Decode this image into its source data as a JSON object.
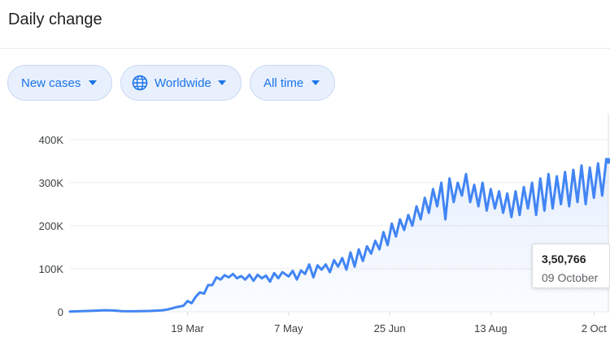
{
  "header": {
    "title": "Daily change"
  },
  "filters": {
    "metric": "New cases",
    "region": "Worldwide",
    "period": "All time"
  },
  "icons": {
    "globe": "globe-icon",
    "dropdown": "caret-down-icon"
  },
  "colors": {
    "line": "#4285f4",
    "accent": "#1a73e8",
    "chip_bg": "#e8f0fe"
  },
  "tooltip": {
    "value": "3,50,766",
    "date": "09 October"
  },
  "chart_data": {
    "type": "area",
    "title": "",
    "xlabel": "",
    "ylabel": "",
    "x_ticks": [
      "19 Mar",
      "7 May",
      "25 Jun",
      "13 Aug",
      "2 Oct"
    ],
    "y_ticks": [
      "0",
      "100K",
      "200K",
      "300K",
      "400K"
    ],
    "ylim": [
      0,
      400000
    ],
    "xlim": [
      "2020-01-22",
      "2020-10-09"
    ],
    "grid": true,
    "series": [
      {
        "x": [
          "2020-01-22",
          "2020-02-01",
          "2020-02-08",
          "2020-02-12",
          "2020-02-16",
          "2020-02-22",
          "2020-03-01",
          "2020-03-07",
          "2020-03-10",
          "2020-03-13",
          "2020-03-15",
          "2020-03-17",
          "2020-03-19",
          "2020-03-21",
          "2020-03-23",
          "2020-03-25",
          "2020-03-27",
          "2020-03-29",
          "2020-03-31",
          "2020-04-02",
          "2020-04-04",
          "2020-04-06",
          "2020-04-08",
          "2020-04-10",
          "2020-04-12",
          "2020-04-14",
          "2020-04-16",
          "2020-04-18",
          "2020-04-20",
          "2020-04-22",
          "2020-04-24",
          "2020-04-26",
          "2020-04-28",
          "2020-04-30",
          "2020-05-02",
          "2020-05-04",
          "2020-05-07",
          "2020-05-09",
          "2020-05-11",
          "2020-05-13",
          "2020-05-15",
          "2020-05-17",
          "2020-05-19",
          "2020-05-21",
          "2020-05-23",
          "2020-05-25",
          "2020-05-27",
          "2020-05-29",
          "2020-05-31",
          "2020-06-02",
          "2020-06-04",
          "2020-06-06",
          "2020-06-08",
          "2020-06-10",
          "2020-06-12",
          "2020-06-14",
          "2020-06-16",
          "2020-06-18",
          "2020-06-20",
          "2020-06-22",
          "2020-06-24",
          "2020-06-26",
          "2020-06-28",
          "2020-06-30",
          "2020-07-02",
          "2020-07-04",
          "2020-07-06",
          "2020-07-08",
          "2020-07-10",
          "2020-07-12",
          "2020-07-14",
          "2020-07-16",
          "2020-07-18",
          "2020-07-20",
          "2020-07-22",
          "2020-07-24",
          "2020-07-26",
          "2020-07-28",
          "2020-07-30",
          "2020-08-01",
          "2020-08-03",
          "2020-08-05",
          "2020-08-07",
          "2020-08-09",
          "2020-08-11",
          "2020-08-13",
          "2020-08-15",
          "2020-08-17",
          "2020-08-19",
          "2020-08-21",
          "2020-08-23",
          "2020-08-25",
          "2020-08-27",
          "2020-08-29",
          "2020-08-31",
          "2020-09-02",
          "2020-09-04",
          "2020-09-06",
          "2020-09-08",
          "2020-09-10",
          "2020-09-12",
          "2020-09-14",
          "2020-09-16",
          "2020-09-18",
          "2020-09-20",
          "2020-09-22",
          "2020-09-24",
          "2020-09-26",
          "2020-09-28",
          "2020-09-30",
          "2020-10-02",
          "2020-10-04",
          "2020-10-06",
          "2020-10-08",
          "2020-10-09"
        ],
        "values": [
          600,
          2000,
          3500,
          3000,
          1500,
          1200,
          1800,
          3500,
          6000,
          10000,
          12000,
          14000,
          25000,
          20000,
          35000,
          45000,
          42000,
          62000,
          62000,
          80000,
          75000,
          85000,
          80000,
          88000,
          78000,
          83000,
          75000,
          86000,
          72000,
          86000,
          78000,
          84000,
          70000,
          90000,
          78000,
          92000,
          82000,
          95000,
          75000,
          96000,
          88000,
          110000,
          80000,
          108000,
          98000,
          110000,
          92000,
          120000,
          105000,
          125000,
          98000,
          138000,
          105000,
          145000,
          118000,
          152000,
          135000,
          165000,
          145000,
          185000,
          155000,
          205000,
          175000,
          215000,
          190000,
          225000,
          200000,
          245000,
          215000,
          265000,
          230000,
          285000,
          245000,
          300000,
          215000,
          310000,
          255000,
          300000,
          270000,
          320000,
          255000,
          295000,
          245000,
          300000,
          235000,
          285000,
          240000,
          280000,
          230000,
          275000,
          220000,
          280000,
          225000,
          290000,
          240000,
          300000,
          225000,
          310000,
          235000,
          320000,
          240000,
          315000,
          250000,
          325000,
          245000,
          330000,
          255000,
          340000,
          250000,
          335000,
          265000,
          345000,
          270000,
          355000,
          350766
        ]
      }
    ]
  }
}
